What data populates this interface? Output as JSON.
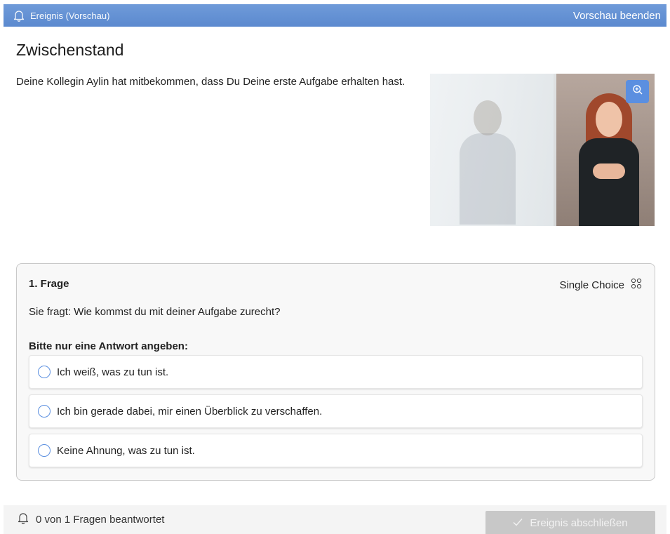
{
  "header": {
    "title": "Ereignis (Vorschau)",
    "end_preview_label": "Vorschau beenden",
    "bell_icon": "bell-icon",
    "color": "#5b89cf"
  },
  "main": {
    "title": "Zwischenstand",
    "intro": "Deine Kollegin Aylin hat mitbekommen, dass Du Deine erste Aufgabe erhalten hast.",
    "image_zoom_icon": "zoom-in-icon"
  },
  "question": {
    "number_label": "1. Frage",
    "type_label": "Single Choice",
    "type_icon": "four-circles-icon",
    "text": "Sie fragt: Wie kommst du mit deiner Aufgabe zurecht?",
    "hint": "Bitte nur eine Antwort angeben:",
    "options": [
      {
        "label": "Ich weiß, was zu tun ist."
      },
      {
        "label": "Ich bin gerade dabei, mir einen Überblick zu verschaffen."
      },
      {
        "label": "Keine Ahnung, was zu tun ist."
      }
    ]
  },
  "footer": {
    "status": "0 von 1 Fragen beantwortet",
    "finish_label": "Ereignis abschließen",
    "check_icon": "check-icon"
  }
}
